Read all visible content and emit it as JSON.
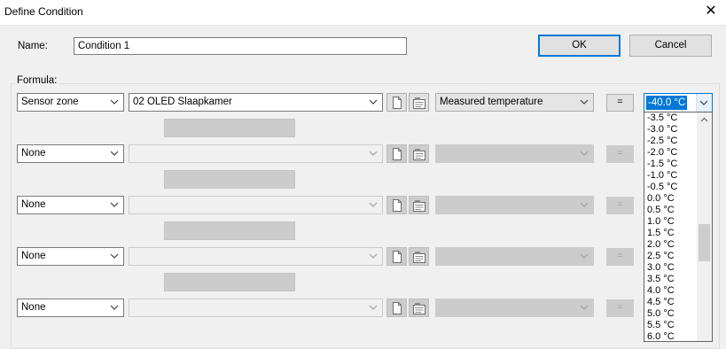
{
  "window": {
    "title": "Define Condition"
  },
  "name_row": {
    "label": "Name:",
    "value": "Condition 1"
  },
  "buttons": {
    "ok": "OK",
    "cancel": "Cancel"
  },
  "formula": {
    "label": "Formula:",
    "rows": [
      {
        "source": "Sensor zone",
        "device": "02  OLED Slaapkamer",
        "property": "Measured temperature",
        "operator": "=",
        "value": "-40.0 °C"
      },
      {
        "source": "None",
        "device": "",
        "property": "",
        "operator": "="
      },
      {
        "source": "None",
        "device": "",
        "property": "",
        "operator": "="
      },
      {
        "source": "None",
        "device": "",
        "property": "",
        "operator": "="
      },
      {
        "source": "None",
        "device": "",
        "property": "",
        "operator": "="
      }
    ]
  },
  "value_dropdown": {
    "options": [
      "-3.5 °C",
      "-3.0 °C",
      "-2.5 °C",
      "-2.0 °C",
      "-1.5 °C",
      "-1.0 °C",
      "-0.5 °C",
      "0.0 °C",
      "0.5 °C",
      "1.0 °C",
      "1.5 °C",
      "2.0 °C",
      "2.5 °C",
      "3.0 °C",
      "3.5 °C",
      "4.0 °C",
      "4.5 °C",
      "5.0 °C",
      "5.5 °C",
      "6.0 °C"
    ]
  },
  "icons": {
    "close": "close-icon",
    "chevron": "chevron-down-icon",
    "document": "document-icon",
    "properties": "properties-icon",
    "scroll_up": "scroll-up-icon"
  }
}
